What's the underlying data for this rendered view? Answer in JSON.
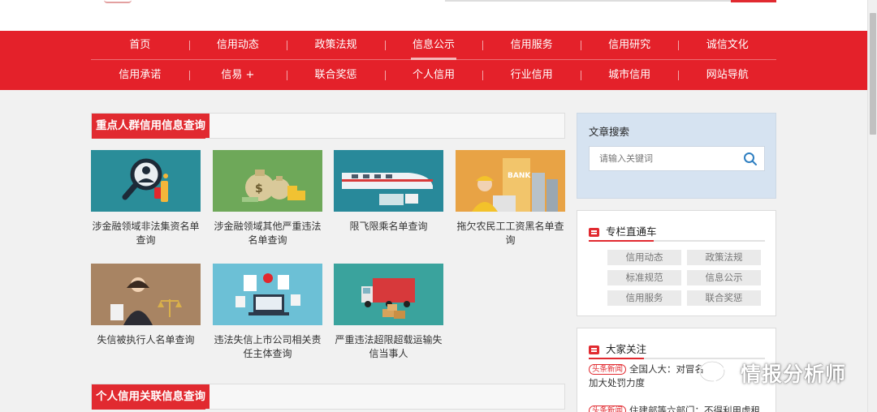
{
  "nav": {
    "row1": [
      "首页",
      "信用动态",
      "政策法规",
      "信息公示",
      "信用服务",
      "信用研究",
      "诚信文化"
    ],
    "row2": [
      "信用承诺",
      "信易 +",
      "联合奖惩",
      "个人信用",
      "行业信用",
      "城市信用",
      "网站导航"
    ],
    "active": "信息公示"
  },
  "section1": {
    "title": "重点人群信用信息查询",
    "cards": [
      {
        "label": "涉金融领域非法集资名单查询",
        "icon": "magnifier-person-icon"
      },
      {
        "label": "涉金融领域其他严重违法名单查询",
        "icon": "money-bags-icon"
      },
      {
        "label": "限飞限乘名单查询",
        "icon": "high-speed-train-icon"
      },
      {
        "label": "拖欠农民工工资黑名单查询",
        "icon": "construction-worker-bank-icon"
      },
      {
        "label": "失信被执行人名单查询",
        "icon": "judge-scales-icon"
      },
      {
        "label": "违法失信上市公司相关责任主体查询",
        "icon": "laptop-documents-icon"
      },
      {
        "label": "严重违法超限超载运输失信当事人",
        "icon": "overloaded-truck-icon"
      }
    ]
  },
  "section2": {
    "title": "个人信用关联信息查询"
  },
  "sidebar": {
    "search": {
      "title": "文章搜索",
      "placeholder": "请输入关键词"
    },
    "column": {
      "title": "专栏直通车",
      "tags": [
        "信用动态",
        "政策法规",
        "标准规范",
        "信息公示",
        "信用服务",
        "联合奖惩"
      ]
    },
    "hot": {
      "title": "大家关注",
      "items": [
        {
          "badge": "头条新闻",
          "text": "全国人大：对冒名",
          "continued": "加大处罚力度"
        },
        {
          "badge": "头条新闻",
          "text": "住建部等六部门：不得利用虚租"
        }
      ]
    }
  },
  "watermark": {
    "text": "情报分析师"
  },
  "colors": {
    "brand_red": "#e4212a",
    "panel_blue": "#d6e3f1"
  }
}
